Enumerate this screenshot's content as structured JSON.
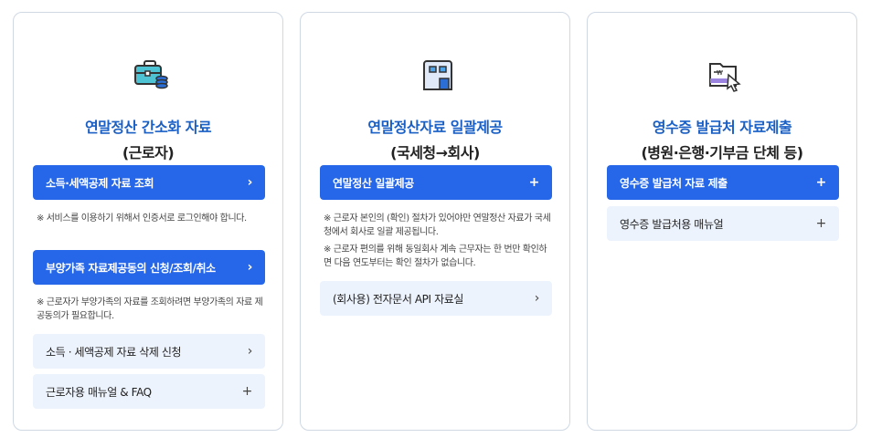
{
  "cards": [
    {
      "icon": "briefcase-coins-icon",
      "title": "연말정산 간소화 자료",
      "subtitle": "(근로자)",
      "buttons": [
        {
          "label": "소득·세액공제 자료 조회",
          "style": "primary",
          "symbol": "›"
        },
        {
          "label": "부양가족 자료제공동의 신청/조회/취소",
          "style": "primary",
          "symbol": "›"
        },
        {
          "label": "소득 · 세액공제 자료 삭제 신청",
          "style": "secondary",
          "symbol": "›"
        },
        {
          "label": "근로자용 매뉴얼 & FAQ",
          "style": "secondary",
          "symbol": "+"
        }
      ],
      "notes": [
        "※ 서비스를 이용하기 위해서 인증서로 로그인해야 합니다.",
        "※ 근로자가 부양가족의 자료를 조회하려면 부양가족의 자료 제공동의가 필요합니다."
      ]
    },
    {
      "icon": "building-icon",
      "title": "연말정산자료 일괄제공",
      "subtitle": "(국세청→회사)",
      "buttons": [
        {
          "label": "연말정산 일괄제공",
          "style": "primary",
          "symbol": "+"
        },
        {
          "label": "(회사용) 전자문서 API 자료실",
          "style": "secondary",
          "symbol": "›"
        }
      ],
      "notes": [
        "※ 근로자 본인의 (확인) 절차가 있어야만 연말정산 자료가 국세청에서 회사로 일괄 제공됩니다.",
        "※ 근로자 편의를 위해 동일회사 계속 근무자는 한 번만 확인하면 다음 연도부터는 확인 절차가 없습니다."
      ]
    },
    {
      "icon": "receipt-folder-cursor-icon",
      "title": "영수증 발급처 자료제출",
      "subtitle": "(병원·은행·기부금 단체 등)",
      "buttons": [
        {
          "label": "영수증 발급처 자료 제출",
          "style": "primary",
          "symbol": "+"
        },
        {
          "label": "영수증 발급처용 매뉴얼",
          "style": "secondary",
          "symbol": "+"
        }
      ],
      "notes": []
    }
  ],
  "colors": {
    "accent_title": "#1a5fc4",
    "primary_button": "#2567e8",
    "secondary_button": "#edf3fd",
    "card_border": "#cfd8e3"
  }
}
